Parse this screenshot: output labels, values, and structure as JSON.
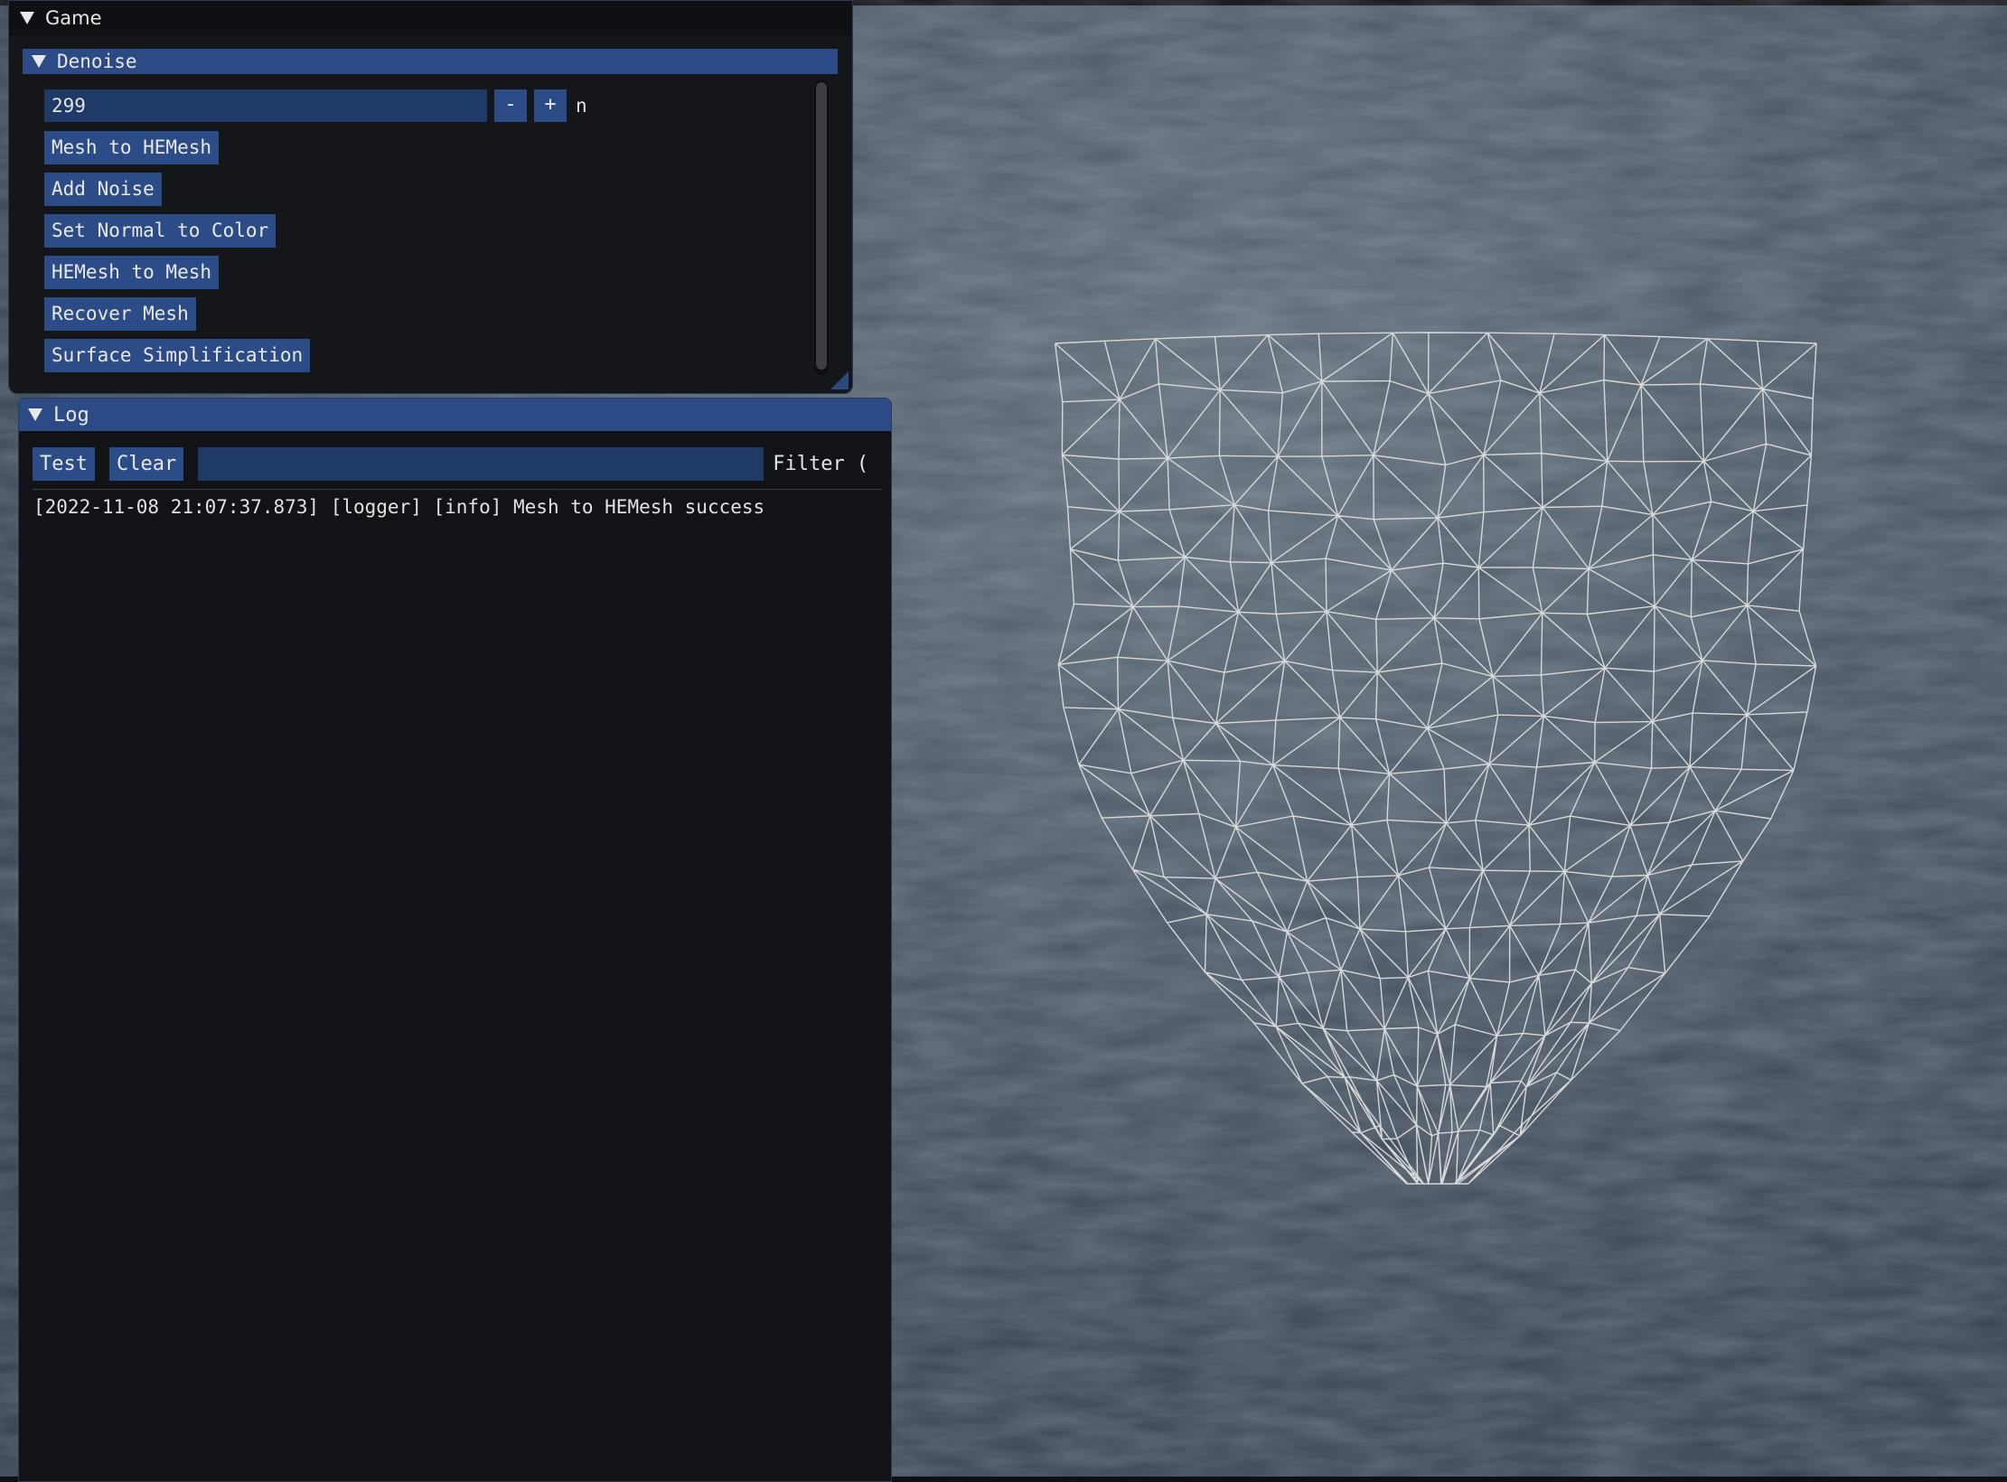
{
  "game_window": {
    "title": "Game",
    "collapse_icon": "triangle-down-icon"
  },
  "denoise": {
    "header": "Denoise",
    "iterations_value": "299",
    "minus_label": "-",
    "plus_label": "+",
    "param_label": "n",
    "buttons": [
      "Mesh to HEMesh",
      "Add Noise",
      "Set Normal to Color",
      "HEMesh to Mesh",
      "Recover Mesh",
      "Surface Simplification"
    ]
  },
  "log_window": {
    "title": "Log",
    "test_label": "Test",
    "clear_label": "Clear",
    "filter_label": "Filter (",
    "entries": [
      "[2022-11-08 21:07:37.873] [logger] [info] Mesh to HEMesh success"
    ]
  },
  "colors": {
    "panel_bg": "#151619",
    "header_blue": "#2c4a85",
    "button_blue": "#2b4c86",
    "field_blue": "#1f3a66",
    "mesh_line": "#d8d8d8"
  }
}
